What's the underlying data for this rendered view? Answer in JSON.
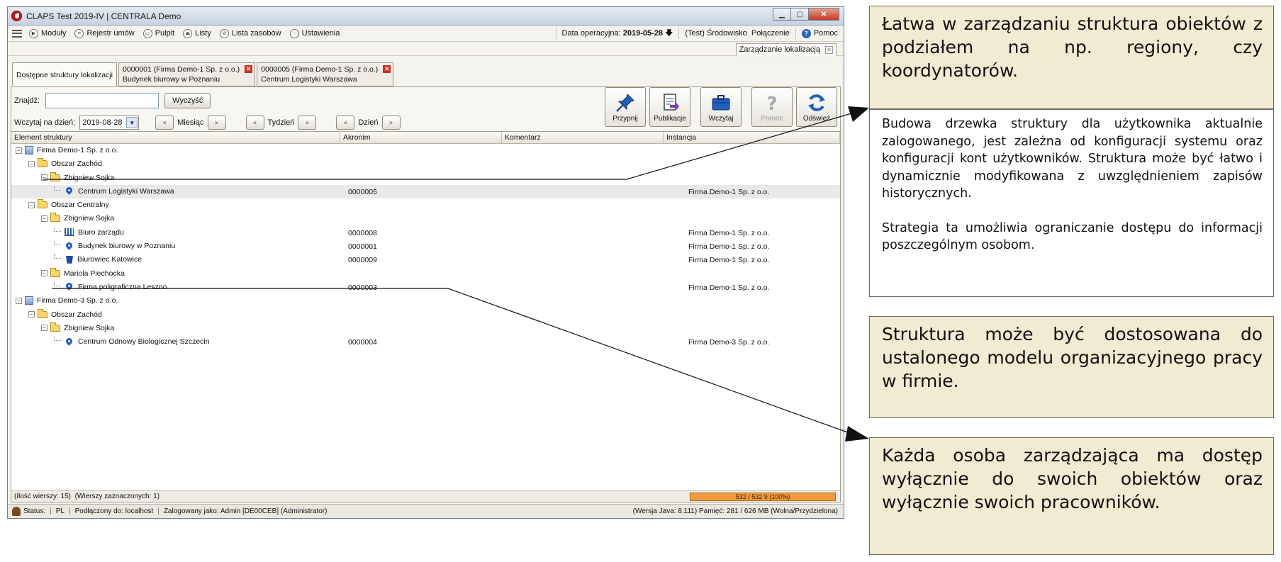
{
  "window": {
    "title": "CLAPS Test 2019-IV | CENTRALA Demo",
    "controls": {
      "minimize": "▁",
      "maximize": "▢",
      "close": "✕"
    }
  },
  "menu": {
    "items": [
      {
        "label": "Moduły",
        "icon": "play-circle-icon"
      },
      {
        "label": "Rejestr umów",
        "icon": "register-icon"
      },
      {
        "label": "Pulpit",
        "icon": "desktop-icon"
      },
      {
        "label": "Listy",
        "icon": "lists-icon"
      },
      {
        "label": "Lista zasobów",
        "icon": "resources-icon"
      },
      {
        "label": "Ustawienia",
        "icon": "settings-icon"
      }
    ],
    "data_operacyjna_label": "Data operacyjna:",
    "data_operacyjna_value": "2019-05-28",
    "env_test": "(Test)",
    "env_label": "Środowisko",
    "connection_label": "Połączenie",
    "help_label": "Pomoc"
  },
  "doc_tab": {
    "label": "Zarządzanie lokalizacją"
  },
  "sub_tabs": [
    {
      "label": "Dostępne struktury lokalizacji"
    },
    {
      "line1": "0000001 (Firma Demo-1 Sp. z o.o.)",
      "line2": "Budynek biurowy w Poznaniu"
    },
    {
      "line1": "0000005 (Firma Demo-1 Sp. z o.o.)",
      "line2": "Centrum Logistyki Warszawa"
    }
  ],
  "search": {
    "label": "Znajdź:",
    "value": "",
    "clear_button": "Wyczyść"
  },
  "date_nav": {
    "label": "Wczytaj na dzień:",
    "value": "2019-08-28",
    "prev": "<",
    "next": ">",
    "month": "Miesiąc",
    "week": "Tydzień",
    "day": "Dzień"
  },
  "toolbar": {
    "pin": "Przypnij",
    "publications": "Publikacje",
    "load": "Wczytaj",
    "help": "Pomoc",
    "refresh": "Odśwież"
  },
  "grid": {
    "columns": [
      "Element struktury",
      "Akronim",
      "Komentarz",
      "Instancja"
    ],
    "rows": [
      {
        "name": "Firma Demo-1 Sp. z o.o.",
        "akronim": "",
        "instancja": ""
      },
      {
        "name": "Obszar Zachód",
        "akronim": "",
        "instancja": ""
      },
      {
        "name": "Zbigniew Sojka",
        "akronim": "",
        "instancja": ""
      },
      {
        "name": "Centrum Logistyki Warszawa",
        "akronim": "0000005",
        "instancja": "Firma Demo-1 Sp. z o.o."
      },
      {
        "name": "Obszar Centralny",
        "akronim": "",
        "instancja": ""
      },
      {
        "name": "Zbigniew Sojka",
        "akronim": "",
        "instancja": ""
      },
      {
        "name": "Biuro zarządu",
        "akronim": "0000008",
        "instancja": "Firma Demo-1 Sp. z o.o."
      },
      {
        "name": "Budynek biurowy w Poznaniu",
        "akronim": "0000001",
        "instancja": "Firma Demo-1 Sp. z o.o."
      },
      {
        "name": "Biurowiec Katowice",
        "akronim": "0000009",
        "instancja": "Firma Demo-1 Sp. z o.o."
      },
      {
        "name": "Mariola Piechocka",
        "akronim": "",
        "instancja": ""
      },
      {
        "name": "Firma poligraficzna Leszno",
        "akronim": "0000003",
        "instancja": "Firma Demo-1 Sp. z o.o."
      },
      {
        "name": "Firma Demo-3 Sp. z o.o.",
        "akronim": "",
        "instancja": ""
      },
      {
        "name": "Obszar Zachód",
        "akronim": "",
        "instancja": ""
      },
      {
        "name": "Zbigniew Sojka",
        "akronim": "",
        "instancja": ""
      },
      {
        "name": "Centrum Odnowy Biologicznej Szczecin",
        "akronim": "0000004",
        "instancja": "Firma Demo-3 Sp. z o.o."
      }
    ],
    "row_count_text": "(Ilość wierszy: 15)",
    "selected_count_text": "(Wierszy zaznaczonych: 1)",
    "progress_text": "532 / 532 9 (100%)",
    "progress_fraction": 1.0
  },
  "statusbar": {
    "status": "Status:",
    "lang": "PL",
    "connected": "Podłączony do: localhost",
    "logged": "Zalogowany jako: Admin [DE00CEB] (Administrator)",
    "right": "(Wersja Java: 8.111)  Pamięć: 281 / 626 MB (Wolna/Przydzielona)"
  },
  "annotations": {
    "a1": "Łatwa w zarządzaniu struktura obiektów z podziałem na np. regiony, czy koordynatorów.",
    "a2_p1": "Budowa drzewka struktury dla użytkownika aktualnie zalogowanego, jest zależna od konfiguracji systemu oraz konfiguracji kont użytkowników. Struktura może być łatwo i dynamicznie modyfikowana z uwzględnieniem zapisów historycznych.",
    "a2_p2": "Strategia ta umożliwia ograniczanie dostępu do informacji poszczególnym osobom.",
    "a3": "Struktura może być dostosowana do ustalonego modelu organizacyjnego pracy w firmie.",
    "a4": "Każda osoba zarządzająca ma dostęp wyłącznie do swoich obiektów oraz wyłącznie swoich pracowników."
  },
  "colors": {
    "accent": "#2a62b8",
    "close": "#c43a22",
    "progress": "#f19a3e",
    "annotation_bg": "#f3ebd1"
  }
}
